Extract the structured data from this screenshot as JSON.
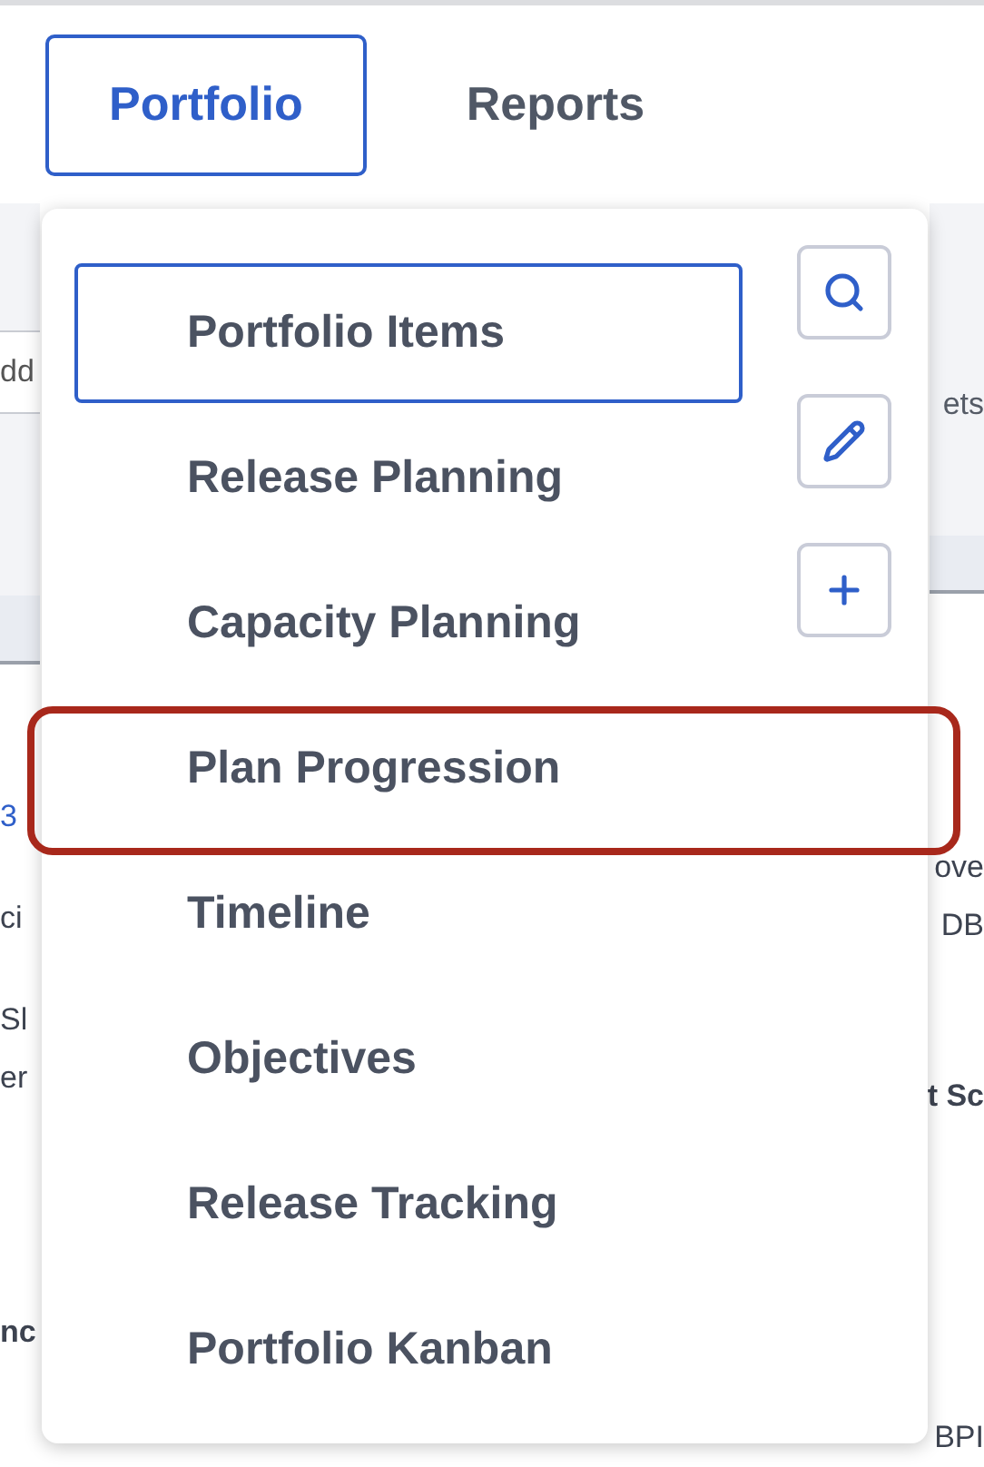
{
  "nav_tabs": [
    {
      "label": "Portfolio",
      "selected": true
    },
    {
      "label": "Reports",
      "selected": false
    }
  ],
  "background": {
    "left_field_value": "dd",
    "left_texts": [
      {
        "text": "3",
        "kind": "link"
      },
      {
        "text": "ci",
        "kind": "text"
      },
      {
        "text": "Sl",
        "kind": "text"
      },
      {
        "text": "er",
        "kind": "text"
      },
      {
        "text": "nc",
        "kind": "label"
      }
    ],
    "right_texts": [
      {
        "text": "ets",
        "kind": "toolbar"
      },
      {
        "text": "ove",
        "kind": "text"
      },
      {
        "text": "DB",
        "kind": "text"
      },
      {
        "text": "t Sc",
        "kind": "label"
      },
      {
        "text": "BPI",
        "kind": "text"
      }
    ]
  },
  "menu": {
    "items": [
      {
        "label": "Portfolio Items",
        "selected": true,
        "highlighted": false
      },
      {
        "label": "Release Planning",
        "selected": false,
        "highlighted": false
      },
      {
        "label": "Capacity Planning",
        "selected": false,
        "highlighted": false
      },
      {
        "label": "Plan Progression",
        "selected": false,
        "highlighted": true
      },
      {
        "label": "Timeline",
        "selected": false,
        "highlighted": false
      },
      {
        "label": "Objectives",
        "selected": false,
        "highlighted": false
      },
      {
        "label": "Release Tracking",
        "selected": false,
        "highlighted": false
      },
      {
        "label": "Portfolio Kanban",
        "selected": false,
        "highlighted": false
      }
    ],
    "actions": [
      {
        "kind": "search"
      },
      {
        "kind": "edit"
      },
      {
        "kind": "add"
      }
    ]
  }
}
